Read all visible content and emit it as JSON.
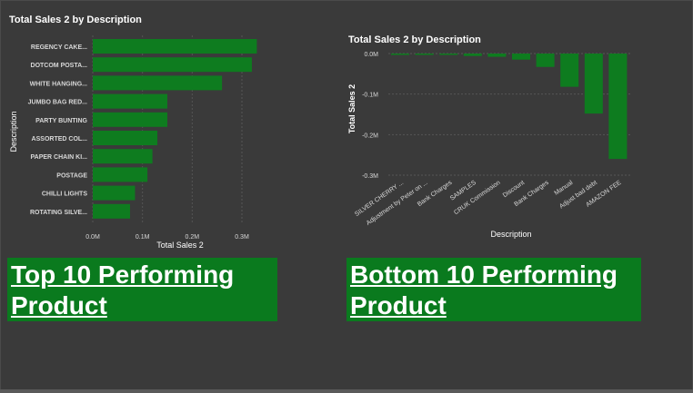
{
  "colors": {
    "bar": "#0e7c1f",
    "background": "#3a3a3a",
    "banner": "#0a7a1e",
    "grid": "#555555",
    "text": "#d8d8d8"
  },
  "chart_data": [
    {
      "type": "bar",
      "orientation": "horizontal",
      "title": "Total Sales 2 by Description",
      "xlabel": "Total Sales 2",
      "ylabel": "Description",
      "categories": [
        "REGENCY CAKE...",
        "DOTCOM POSTA...",
        "WHITE HANGING...",
        "JUMBO BAG RED...",
        "PARTY BUNTING",
        "ASSORTED COL...",
        "PAPER CHAIN KI...",
        "POSTAGE",
        "CHILLI LIGHTS",
        "ROTATING SILVE..."
      ],
      "values": [
        0.33,
        0.32,
        0.26,
        0.15,
        0.15,
        0.13,
        0.12,
        0.11,
        0.085,
        0.075
      ],
      "xticks": [
        "0.0M",
        "0.1M",
        "0.2M",
        "0.3M"
      ],
      "xlim": [
        0,
        0.3
      ],
      "unit": "M",
      "grid": true
    },
    {
      "type": "bar",
      "orientation": "vertical",
      "title": "Total Sales 2 by Description",
      "xlabel": "Description",
      "ylabel": "Total Sales 2",
      "categories": [
        "SILVER CHERRY ...",
        "Adjustment by Peter on ...",
        "Bank Charges",
        "SAMPLES",
        "CRUK Commission",
        "Discount",
        "Bank Charges",
        "Manual",
        "Adjust bad debt",
        "AMAZON FEE"
      ],
      "values": [
        -0.001,
        -0.002,
        -0.003,
        -0.006,
        -0.008,
        -0.015,
        -0.033,
        -0.082,
        -0.148,
        -0.26
      ],
      "yticks": [
        "0.0M",
        "-0.1M",
        "-0.2M",
        "-0.3M"
      ],
      "ylim": [
        -0.3,
        0
      ],
      "unit": "M",
      "grid": true
    }
  ],
  "banners": {
    "top": "Top 10 Performing Product",
    "bottom": "Bottom 10 Performing Product"
  }
}
